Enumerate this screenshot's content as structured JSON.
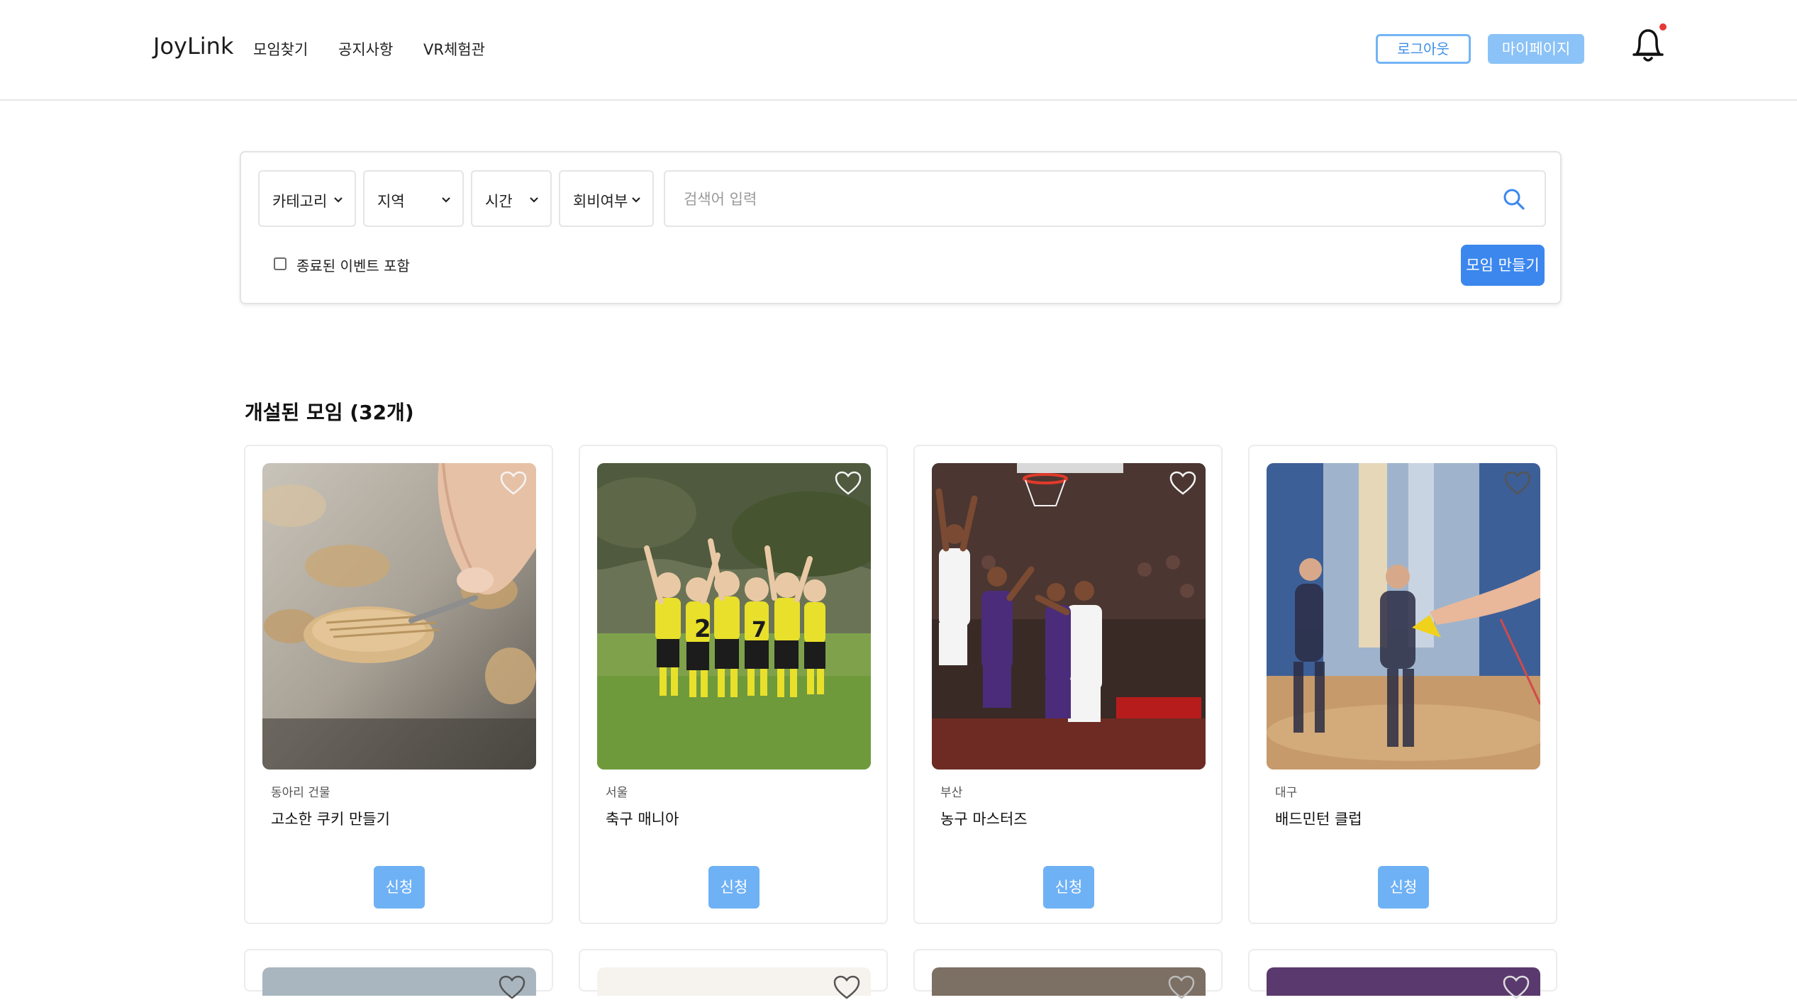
{
  "header": {
    "logo": "JoyLink",
    "nav": [
      "모임찾기",
      "공지사항",
      "VR체험관"
    ],
    "logout_label": "로그아웃",
    "mypage_label": "마이페이지",
    "notification_dot_color": "#e53935"
  },
  "filters": {
    "category": "카테고리",
    "region": "지역",
    "time": "시간",
    "fee": "회비여부",
    "search_placeholder": "검색어 입력",
    "include_ended_label": "종료된 이벤트 포함",
    "include_ended_checked": false,
    "create_label": "모임 만들기"
  },
  "section": {
    "title": "개설된 모임 (32개)"
  },
  "cards": [
    {
      "location": "동아리 건물",
      "name": "고소한 쿠키 만들기",
      "apply": "신청",
      "image": "cookie-photo"
    },
    {
      "location": "서울",
      "name": "축구 매니아",
      "apply": "신청",
      "image": "kids-soccer-photo"
    },
    {
      "location": "부산",
      "name": "농구 마스터즈",
      "apply": "신청",
      "image": "basketball-photo"
    },
    {
      "location": "대구",
      "name": "배드민턴 클럽",
      "apply": "신청",
      "image": "badminton-photo"
    }
  ],
  "colors": {
    "accent": "#3c87ee",
    "apply_button": "#6fb1f5",
    "mypage_button": "#8bc2f7"
  }
}
